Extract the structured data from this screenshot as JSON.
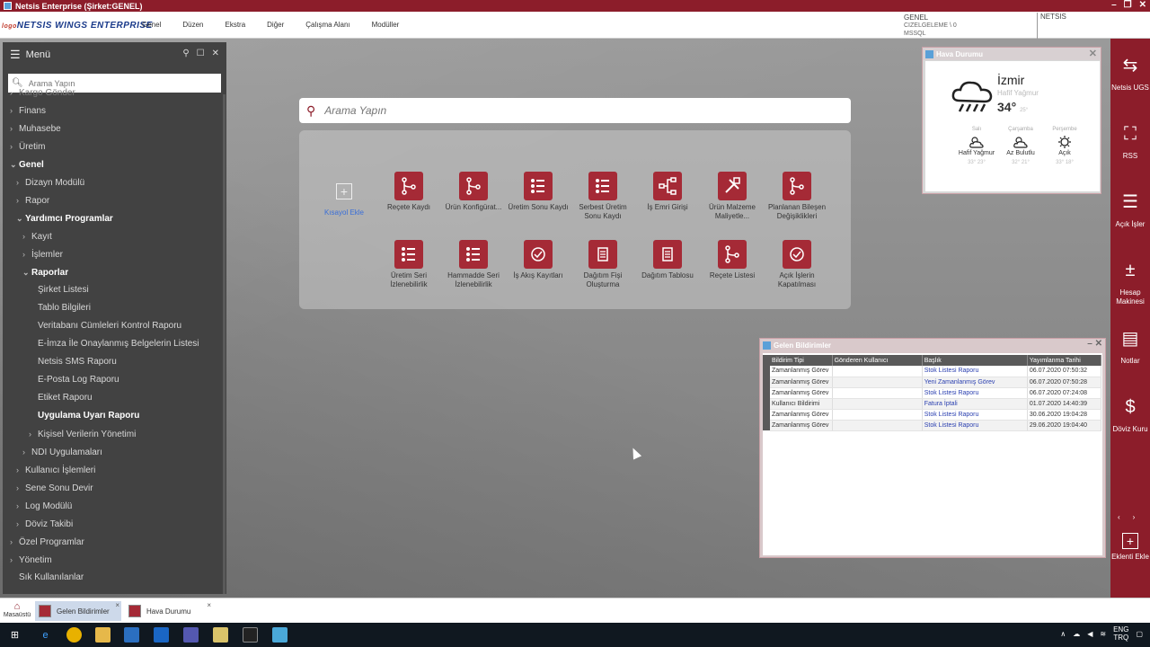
{
  "window": {
    "title": "Netsis Enterprise (Şirket:GENEL)"
  },
  "menubar": {
    "logo_small": "logo",
    "logo": "NETSIS WINGS ENTERPRISE",
    "items": [
      "Genel",
      "Düzen",
      "Ekstra",
      "Diğer",
      "Çalışma Alanı",
      "Modüller"
    ],
    "company": "GENEL",
    "company_sub1": "CIZELGELEME \\ 0",
    "company_sub2": "MSSQL",
    "netsis_label": "NETSIS"
  },
  "menu": {
    "title": "Menü",
    "search_placeholder": "Arama Yapın",
    "items": [
      {
        "label": "Kargo Gönder",
        "indent": 1,
        "chev": "›",
        "bold": false
      },
      {
        "label": "Finans",
        "indent": 1,
        "chev": "›",
        "bold": false
      },
      {
        "label": "Muhasebe",
        "indent": 1,
        "chev": "›",
        "bold": false
      },
      {
        "label": "Üretim",
        "indent": 1,
        "chev": "›",
        "bold": false
      },
      {
        "label": "Genel",
        "indent": 1,
        "chev": "⌄",
        "bold": true
      },
      {
        "label": "Dizayn Modülü",
        "indent": 2,
        "chev": "›",
        "bold": false
      },
      {
        "label": "Rapor",
        "indent": 2,
        "chev": "›",
        "bold": false
      },
      {
        "label": "Yardımcı Programlar",
        "indent": 2,
        "chev": "⌄",
        "bold": true
      },
      {
        "label": "Kayıt",
        "indent": 3,
        "chev": "›",
        "bold": false
      },
      {
        "label": "İşlemler",
        "indent": 3,
        "chev": "›",
        "bold": false
      },
      {
        "label": "Raporlar",
        "indent": 3,
        "chev": "⌄",
        "bold": true
      },
      {
        "label": "Şirket Listesi",
        "indent": 4,
        "chev": "",
        "bold": false
      },
      {
        "label": "Tablo Bilgileri",
        "indent": 4,
        "chev": "",
        "bold": false
      },
      {
        "label": "Veritabanı Cümleleri Kontrol Raporu",
        "indent": 4,
        "chev": "",
        "bold": false
      },
      {
        "label": "E-İmza İle Onaylanmış Belgelerin Listesi",
        "indent": 4,
        "chev": "",
        "bold": false
      },
      {
        "label": "Netsis SMS Raporu",
        "indent": 4,
        "chev": "",
        "bold": false
      },
      {
        "label": "E-Posta Log Raporu",
        "indent": 4,
        "chev": "",
        "bold": false
      },
      {
        "label": "Etiket Raporu",
        "indent": 4,
        "chev": "",
        "bold": false
      },
      {
        "label": "Uygulama Uyarı Raporu",
        "indent": 4,
        "chev": "",
        "bold": true
      },
      {
        "label": "Kişisel Verilerin Yönetimi",
        "indent": 4,
        "chev": "›",
        "bold": false
      },
      {
        "label": "NDI Uygulamaları",
        "indent": 3,
        "chev": "›",
        "bold": false
      },
      {
        "label": "Kullanıcı İşlemleri",
        "indent": 2,
        "chev": "›",
        "bold": false
      },
      {
        "label": "Sene Sonu Devir",
        "indent": 2,
        "chev": "›",
        "bold": false
      },
      {
        "label": "Log Modülü",
        "indent": 2,
        "chev": "›",
        "bold": false
      },
      {
        "label": "Döviz Takibi",
        "indent": 2,
        "chev": "›",
        "bold": false
      },
      {
        "label": "Özel Programlar",
        "indent": 1,
        "chev": "›",
        "bold": false
      },
      {
        "label": "Yönetim",
        "indent": 1,
        "chev": "›",
        "bold": false
      },
      {
        "label": "Sık Kullanılanlar",
        "indent": 1,
        "chev": "",
        "bold": false
      }
    ]
  },
  "search": {
    "placeholder": "Arama Yapın"
  },
  "shortcuts": [
    {
      "label": "Kısayol Ekle",
      "icon": "add-icon"
    },
    {
      "label": "Reçete Kaydı",
      "icon": "tree-icon"
    },
    {
      "label": "Ürün Konfigürat...",
      "icon": "tree-check-icon"
    },
    {
      "label": "Üretim Sonu Kaydı",
      "icon": "list-icon"
    },
    {
      "label": "Serbest Üretim Sonu Kaydı",
      "icon": "list-icon"
    },
    {
      "label": "İş Emri Girişi",
      "icon": "network-icon"
    },
    {
      "label": "Ürün Malzeme Maliyetle...",
      "icon": "tools-icon"
    },
    {
      "label": "Planlanan Bileşen Değişiklikleri",
      "icon": "tree-icon"
    },
    {
      "label": "Üretim Seri İzlenebilirlik",
      "icon": "list-down-icon"
    },
    {
      "label": "Hammadde Seri İzlenebilirlik",
      "icon": "list-down-icon"
    },
    {
      "label": "İş Akış Kayıtları",
      "icon": "cycle-icon"
    },
    {
      "label": "Dağıtım Fişi Oluşturma",
      "icon": "doc-cycle-icon"
    },
    {
      "label": "Dağıtım Tablosu",
      "icon": "doc-cycle-icon"
    },
    {
      "label": "Reçete Listesi",
      "icon": "tree-down-icon"
    },
    {
      "label": "Açık İşlerin Kapatılması",
      "icon": "cycle-icon"
    }
  ],
  "weather": {
    "title": "Hava Durumu",
    "city": "İzmir",
    "condition": "Hafif Yağmur",
    "temp": "34°",
    "temp_low": "25°",
    "days": [
      {
        "name": "Salı",
        "cond": "Hafif Yağmur",
        "temps": "33° 23°"
      },
      {
        "name": "Çarşamba",
        "cond": "Az Bulutlu",
        "temps": "32° 21°"
      },
      {
        "name": "Perşembe",
        "cond": "Açık",
        "temps": "33° 18°"
      }
    ]
  },
  "notifications": {
    "title": "Gelen Bildirimler",
    "columns": [
      "Bildirim Tipi",
      "Gönderen Kullanıcı",
      "Başlık",
      "Yayımlanma Tarihi"
    ],
    "rows": [
      [
        "Zamanlanmış Görev",
        "",
        "Stok Listesi Raporu",
        "06.07.2020 07:50:32"
      ],
      [
        "Zamanlanmış Görev",
        "",
        "Yeni Zamanlanmış Görev",
        "06.07.2020 07:50:28"
      ],
      [
        "Zamanlanmış Görev",
        "",
        "Stok Listesi Raporu",
        "06.07.2020 07:24:08"
      ],
      [
        "Kullanıcı Bildirimi",
        "",
        "Fatura İptali",
        "01.07.2020 14:40:39"
      ],
      [
        "Zamanlanmış Görev",
        "",
        "Stok Listesi Raporu",
        "30.06.2020 19:04:28"
      ],
      [
        "Zamanlanmış Görev",
        "",
        "Stok Listesi Raporu",
        "29.06.2020 19:04:40"
      ]
    ]
  },
  "right_sidebar": [
    {
      "label": "Netsis UGS",
      "icon": "user-swap-icon"
    },
    {
      "label": "RSS",
      "icon": "expand-icon"
    },
    {
      "label": "Açık İşler",
      "icon": "checklist-icon"
    },
    {
      "label": "Hesap Makinesi",
      "icon": "calculator-icon"
    },
    {
      "label": "Notlar",
      "icon": "note-icon"
    },
    {
      "label": "Döviz Kuru",
      "icon": "currency-icon"
    },
    {
      "label": "Eklenti Ekle",
      "icon": "add-icon"
    }
  ],
  "taskbar": {
    "desktop": "Masaüstü",
    "tabs": [
      "Gelen Bildirimler",
      "Hava Durumu"
    ]
  },
  "tray": {
    "lang1": "ENG",
    "lang2": "TRQ"
  },
  "colors": {
    "brand": "#8c1d2a",
    "menu_bg": "#424242",
    "link": "#2a3fb0"
  }
}
